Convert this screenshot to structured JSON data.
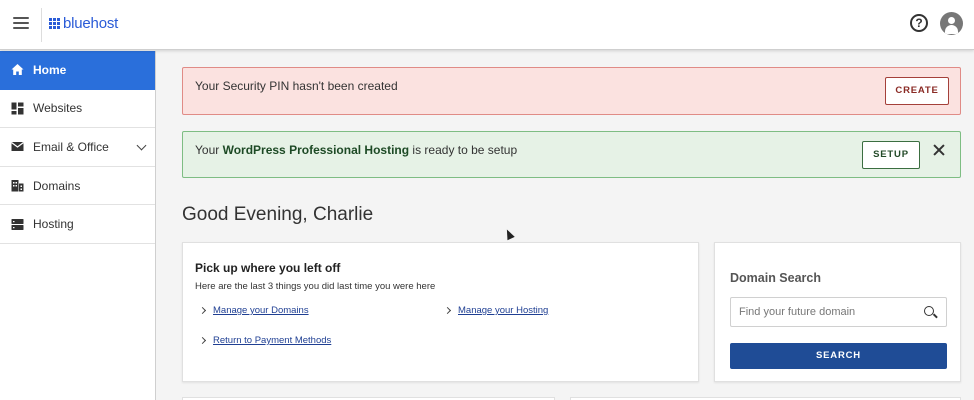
{
  "header": {
    "logo_text": "bluehost",
    "menu_icon": "hamburger-menu-icon",
    "help_icon": "help-circle-icon",
    "help_glyph": "?",
    "avatar_icon": "user-avatar-icon"
  },
  "sidebar": {
    "items": [
      {
        "label": "Home",
        "icon": "home-icon",
        "active": true
      },
      {
        "label": "Websites",
        "icon": "websites-grid-icon"
      },
      {
        "label": "Email & Office",
        "icon": "envelope-icon",
        "expandable": true
      },
      {
        "label": "Domains",
        "icon": "domains-building-icon"
      },
      {
        "label": "Hosting",
        "icon": "server-icon"
      }
    ]
  },
  "alerts": {
    "security": {
      "text": "Your Security PIN hasn't been created",
      "button": "CREATE"
    },
    "wordpress": {
      "prefix": "Your ",
      "bold": "WordPress Professional Hosting",
      "suffix": " is ready to be setup",
      "button": "SETUP"
    }
  },
  "greeting": "Good Evening, Charlie",
  "pickup_card": {
    "title": "Pick up where you left off",
    "subtitle": "Here are the last 3 things you did last time you were here",
    "links": [
      "Manage your Domains",
      "Manage your Hosting",
      "Return to Payment Methods"
    ]
  },
  "domain_search": {
    "title": "Domain Search",
    "placeholder": "Find your future domain",
    "value": "",
    "button": "SEARCH"
  },
  "colors": {
    "brand_blue": "#2a5bd7",
    "nav_active": "#2a6fdb",
    "search_button": "#1f4c96",
    "alert_red_bg": "#fbe2e0",
    "alert_green_bg": "#e6f2e6"
  }
}
